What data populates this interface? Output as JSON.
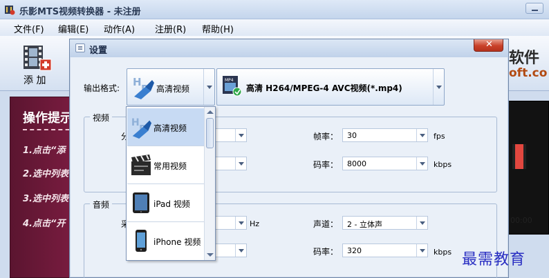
{
  "app": {
    "title": "乐影MTS视频转换器 - 未注册",
    "icon": "app-icon"
  },
  "menu": [
    "文件(F)",
    "编辑(E)",
    "动作(A)",
    "注册(R)",
    "帮助(H)"
  ],
  "toolbar": {
    "add_label": "添 加",
    "brand_line1": "软件",
    "brand_line2": "oft.co"
  },
  "ops_panel": {
    "heading": "操作提示",
    "steps": [
      "1.点击“添",
      "2.选中列表",
      "3.选中列表",
      "4.点击“开"
    ]
  },
  "preview": {
    "time": "00:00"
  },
  "dialog": {
    "title": "设置",
    "format_label": "输出格式:",
    "format_category": "高清视频",
    "format_detail": "高清 H264/MPEG-4 AVC视频(*.mp4)",
    "video_group": "视频",
    "audio_group": "音频",
    "video": {
      "label_a": "分",
      "frame_rate_label": "帧率：",
      "frame_rate_value": "30",
      "frame_rate_unit": "fps",
      "bitrate_label": "码率：",
      "bitrate_value": "8000",
      "bitrate_unit": "kbps"
    },
    "audio": {
      "label_a": "采",
      "sample_unit": "Hz",
      "channel_label": "声道：",
      "channel_value": "2 - 立体声",
      "bitrate_label": "码率：",
      "bitrate_value": "320",
      "bitrate_unit": "kbps"
    }
  },
  "dropdown": {
    "items": [
      {
        "label": "高清视频",
        "icon": "hd-video-icon",
        "selected": true
      },
      {
        "label": "常用视频",
        "icon": "clapperboard-icon",
        "selected": false
      },
      {
        "label": "iPad 视频",
        "icon": "ipad-icon",
        "selected": false
      },
      {
        "label": "iPhone 视频",
        "icon": "iphone-icon",
        "selected": false
      }
    ]
  },
  "watermark": "最需教育",
  "colors": {
    "accent": "#c7daf3",
    "ops_bg": "#7e1d42",
    "close": "#c9412a"
  }
}
